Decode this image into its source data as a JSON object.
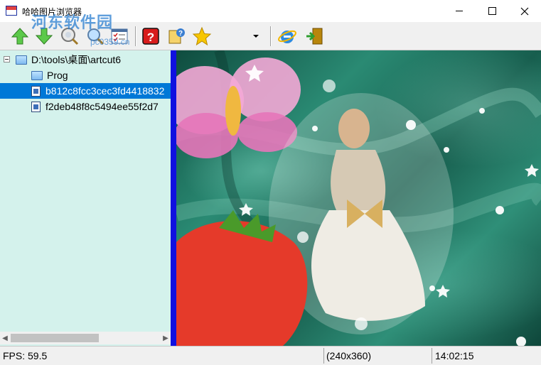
{
  "window": {
    "title": "哈哈图片浏览器",
    "watermark": "河东软件园",
    "watermark_url": "pc0359.cn"
  },
  "toolbar": {
    "buttons": [
      {
        "name": "up-arrow-icon"
      },
      {
        "name": "down-arrow-icon"
      },
      {
        "name": "zoom-icon"
      },
      {
        "name": "search-icon"
      },
      {
        "name": "checklist-icon"
      },
      {
        "name": "help-icon"
      },
      {
        "name": "info-help-icon"
      },
      {
        "name": "favorite-star-icon"
      },
      {
        "name": "internet-explorer-icon"
      },
      {
        "name": "exit-door-icon"
      }
    ]
  },
  "tree": {
    "root": "D:\\tools\\桌面\\artcut6",
    "items": [
      {
        "label": "Prog",
        "type": "folder"
      },
      {
        "label": "b812c8fcc3cec3fd4418832",
        "type": "file",
        "selected": true
      },
      {
        "label": "f2deb48f8c5494ee55f2d7",
        "type": "file"
      }
    ]
  },
  "status": {
    "fps": "FPS: 59.5",
    "dimensions": "(240x360)",
    "time": "14:02:15"
  },
  "colors": {
    "selection": "#0078d7",
    "tree_background": "#d4f2ec",
    "splitter": "#1010e0"
  }
}
